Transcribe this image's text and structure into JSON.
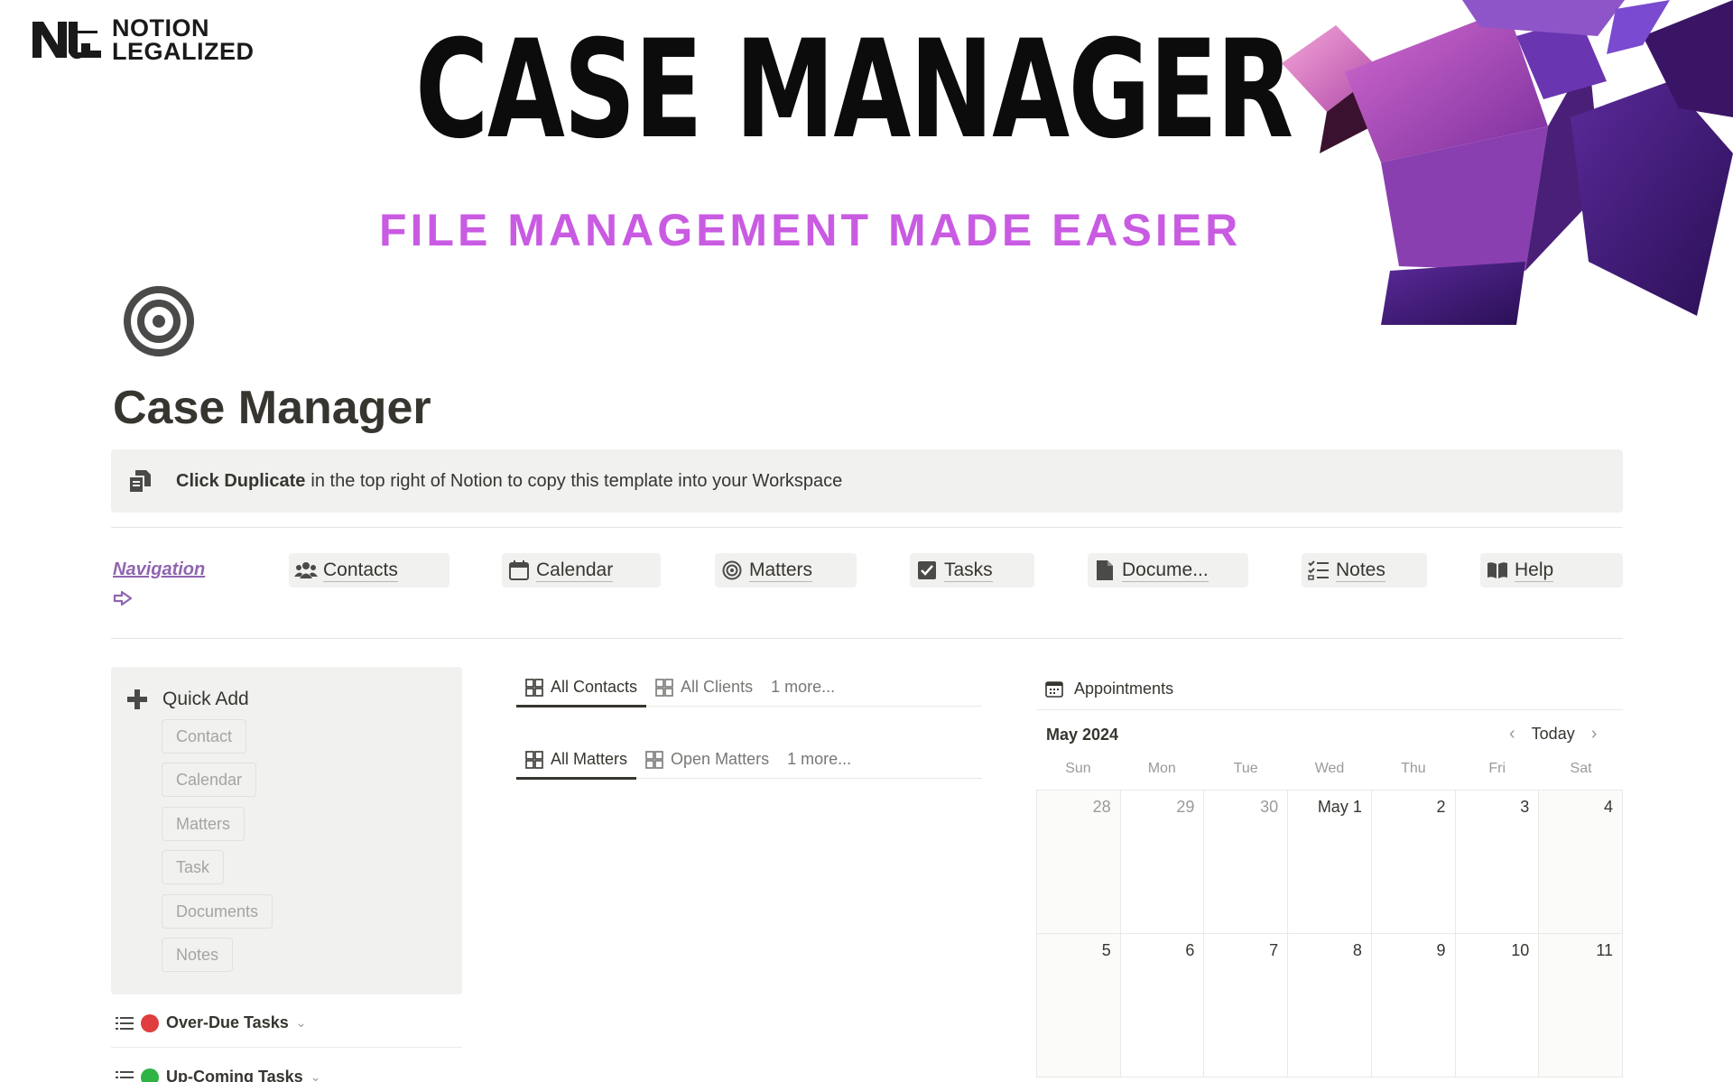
{
  "cover": {
    "brand_line1": "NOTION",
    "brand_line2": "LEGALIZED",
    "title": "CASE MANAGER",
    "subtitle": "FILE MANAGEMENT MADE EASIER",
    "subtitle_color": "#c95be2"
  },
  "page": {
    "icon": "target-icon",
    "title": "Case Manager"
  },
  "callout": {
    "icon": "duplicate-pages-icon",
    "bold": "Click Duplicate",
    "text": "in the top right of Notion to copy this template into your Workspace"
  },
  "navigation": {
    "label": "Navigation",
    "arrow_icon": "arrow-right-icon",
    "label_color": "#9065b0",
    "items": [
      {
        "label": "Contacts",
        "icon": "people-icon"
      },
      {
        "label": "Calendar",
        "icon": "calendar-icon"
      },
      {
        "label": "Matters",
        "icon": "target-icon"
      },
      {
        "label": "Tasks",
        "icon": "checkbox-icon"
      },
      {
        "label": "Docume...",
        "icon": "document-icon"
      },
      {
        "label": "Notes",
        "icon": "checklist-icon"
      },
      {
        "label": "Help",
        "icon": "book-icon"
      }
    ]
  },
  "quick_add": {
    "title": "Quick Add",
    "buttons": [
      "Contact",
      "Calendar",
      "Matters",
      "Task",
      "Documents",
      "Notes"
    ]
  },
  "toggles": [
    {
      "label": "Over-Due Tasks",
      "dot_color": "#e03e3e"
    },
    {
      "label": "Up-Coming Tasks",
      "dot_color": "#2fb344"
    }
  ],
  "contacts_tabs": [
    {
      "label": "All Contacts",
      "active": true
    },
    {
      "label": "All Clients",
      "active": false
    },
    {
      "label": "1 more...",
      "active": false
    }
  ],
  "matters_tabs": [
    {
      "label": "All Matters",
      "active": true
    },
    {
      "label": "Open Matters",
      "active": false
    },
    {
      "label": "1 more...",
      "active": false
    }
  ],
  "calendar": {
    "title": "Appointments",
    "month": "May 2024",
    "today_label": "Today",
    "weekdays": [
      "Sun",
      "Mon",
      "Tue",
      "Wed",
      "Thu",
      "Fri",
      "Sat"
    ],
    "days": [
      "28",
      "29",
      "30",
      "May 1",
      "2",
      "3",
      "4",
      "5",
      "6",
      "7",
      "8",
      "9",
      "10",
      "11"
    ]
  }
}
